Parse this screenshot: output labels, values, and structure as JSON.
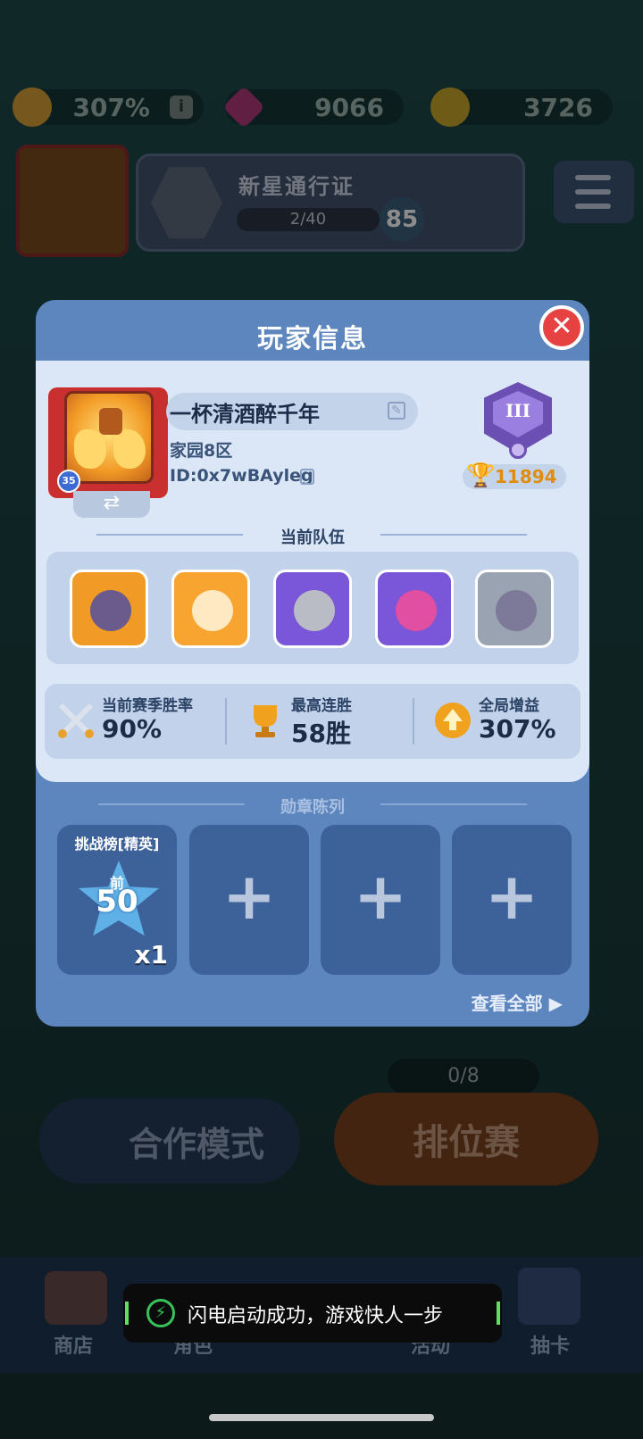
{
  "hud": {
    "bonus": "307%",
    "gems": "9066",
    "coins": "3726",
    "pass_title": "新星通行证",
    "pass_progress": "2/40",
    "pass_level": "85"
  },
  "modal": {
    "title": "玩家信息",
    "close_icon": "close-icon",
    "player": {
      "name": "一杯清酒醉千年",
      "server": "家园8区",
      "id": "ID:0x7wBAyleg",
      "level": "35",
      "rank_numeral": "III",
      "trophies": "11894"
    },
    "team_section_title": "当前队伍",
    "team": [
      {
        "name": "dark-knight-hero",
        "color": "#f29a26",
        "face": "#6b5a8c"
      },
      {
        "name": "angel-hero",
        "color": "#f7a530",
        "face": "#ffe9c2"
      },
      {
        "name": "armored-knight-hero",
        "color": "#7a56d8",
        "face": "#b9bcc4"
      },
      {
        "name": "pink-brawler-hero",
        "color": "#7a56d8",
        "face": "#e04fa1"
      },
      {
        "name": "shadow-archer-hero",
        "color": "#9aa3b2",
        "face": "#7d7a99"
      }
    ],
    "stats": [
      {
        "label": "当前赛季胜率",
        "value": "90%",
        "icon": "crossed-swords-icon"
      },
      {
        "label": "最高连胜",
        "value": "58胜",
        "icon": "trophy-icon"
      },
      {
        "label": "全局增益",
        "value": "307%",
        "icon": "bonus-arrow-icon"
      }
    ],
    "medals_section_title": "勋章陈列",
    "medal": {
      "label": "挑战榜[精英]",
      "star_top": "前",
      "star_num": "50",
      "count": "x1"
    },
    "empty_slot_symbol": "+",
    "view_all": "查看全部"
  },
  "bottom": {
    "coop": "合作模式",
    "ranked": "排位赛",
    "tickets": "0/8",
    "nav": [
      "商店",
      "角色",
      "活动",
      "抽卡"
    ]
  },
  "toast": {
    "text": "闪电启动成功，游戏快人一步"
  },
  "colors": {
    "modal_header": "#5c86bd",
    "panel": "#dbe6f6",
    "close": "#e64242",
    "trophy": "#e08c0f"
  }
}
